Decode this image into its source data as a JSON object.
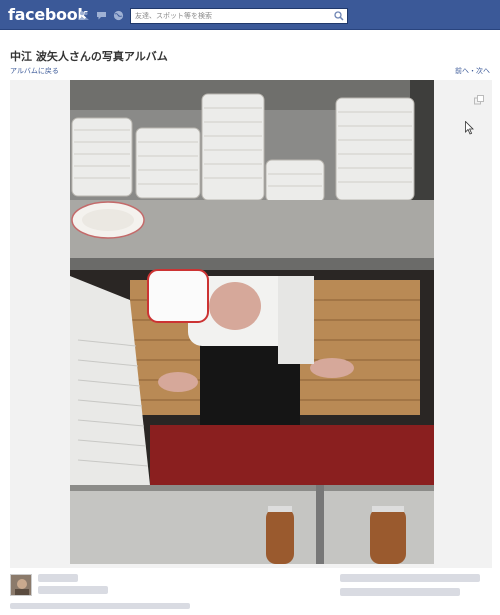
{
  "header": {
    "logo": "facebook",
    "search_placeholder": "友達、スポット等を検索"
  },
  "album": {
    "title": "中江 波矢人さんの写真アルバム",
    "back_link": "アルバムに戻る",
    "prev_next": "前へ・次へ"
  },
  "icons": {
    "friend_requests": "friends-icon",
    "messages": "messages-icon",
    "notifications": "globe-icon",
    "search": "search-icon",
    "expand": "expand-icon",
    "cursor": "mouse-cursor-icon"
  },
  "colors": {
    "brand": "#3b5998",
    "link": "#3b5998"
  }
}
